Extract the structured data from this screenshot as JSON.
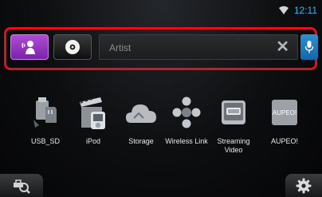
{
  "status_bar": {
    "clock": "12:11",
    "wifi_icon": "wifi-icon"
  },
  "search_bar": {
    "voice_button_icon": "voice-search-icon",
    "disc_button_icon": "disc-icon",
    "placeholder": "Artist",
    "clear_icon": "close-icon",
    "clear_glyph": "✕",
    "mic_icon": "microphone-icon",
    "highlight_color": "#e0111a"
  },
  "sources": [
    {
      "label": "USB_SD",
      "icon": "usb-sd-icon"
    },
    {
      "label": "iPod",
      "icon": "ipod-icon"
    },
    {
      "label": "Storage",
      "icon": "storage-icon"
    },
    {
      "label": "Wireless Link",
      "icon": "wireless-link-icon"
    },
    {
      "label": "Streaming Video",
      "icon": "streaming-video-icon"
    },
    {
      "label": "AUPEO!",
      "icon": "aupeo-icon",
      "logo_text": "AUPEO!"
    }
  ],
  "bottom_bar": {
    "back_icon": "back-search-icon",
    "settings_icon": "gear-icon"
  },
  "colors": {
    "accent_purple": "#9b3bc8",
    "clock_blue": "#36b7e6",
    "mic_blue": "#1e7fc2"
  }
}
